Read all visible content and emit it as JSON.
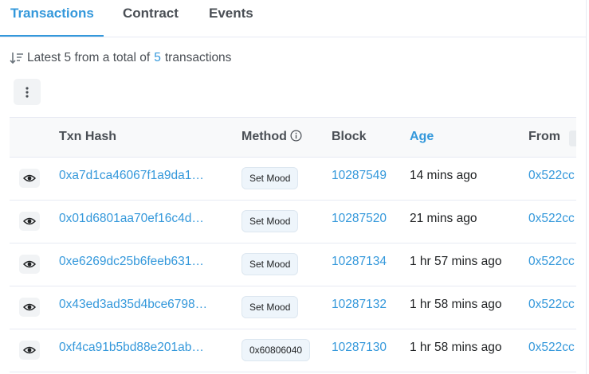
{
  "tabs": [
    {
      "label": "Transactions",
      "active": true
    },
    {
      "label": "Contract",
      "active": false
    },
    {
      "label": "Events",
      "active": false
    }
  ],
  "summary": {
    "prefix": "Latest 5 from a total of",
    "count": "5",
    "suffix": "transactions"
  },
  "table": {
    "headers": {
      "txn_hash": "Txn Hash",
      "method": "Method",
      "block": "Block",
      "age": "Age",
      "from": "From"
    },
    "rows": [
      {
        "hash": "0xa7d1ca46067f1a9da1…",
        "method": "Set Mood",
        "block": "10287549",
        "age": "14 mins ago",
        "from": "0x522cc"
      },
      {
        "hash": "0x01d6801aa70ef16c4d…",
        "method": "Set Mood",
        "block": "10287520",
        "age": "21 mins ago",
        "from": "0x522cc"
      },
      {
        "hash": "0xe6269dc25b6feeb631…",
        "method": "Set Mood",
        "block": "10287134",
        "age": "1 hr 57 mins ago",
        "from": "0x522cc"
      },
      {
        "hash": "0x43ed3ad35d4bce6798…",
        "method": "Set Mood",
        "block": "10287132",
        "age": "1 hr 58 mins ago",
        "from": "0x522cc"
      },
      {
        "hash": "0xf4ca91b5bd88e201ab…",
        "method": "0x60806040",
        "block": "10287130",
        "age": "1 hr 58 mins ago",
        "from": "0x522cc"
      }
    ]
  },
  "colors": {
    "accent": "#3498db",
    "text": "#1e2022",
    "muted": "#4a4f55",
    "header_bg": "#f8f9fa",
    "badge_bg": "#eef5fb",
    "border": "#e7eaf3"
  },
  "icons": {
    "sort": "sort-descending-icon",
    "menu": "vertical-ellipsis-icon",
    "info": "info-circle-icon",
    "eye": "eye-icon"
  }
}
